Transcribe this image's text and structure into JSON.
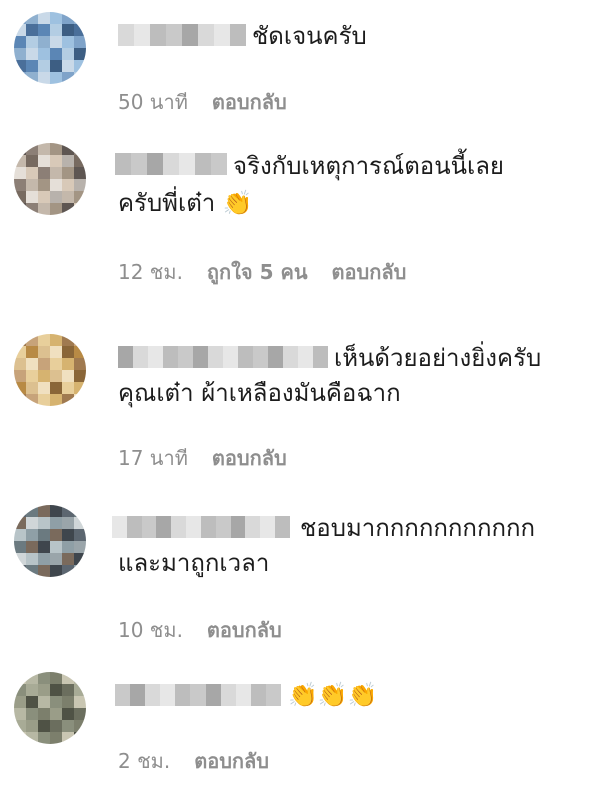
{
  "comments": [
    {
      "text_line1": "ชัดเจนครับ",
      "text_line2": "",
      "time": "50 นาที",
      "likes": "",
      "reply": "ตอบกลับ"
    },
    {
      "text_line1": "จริงกับเหตุการณ์ตอนนี้เลย",
      "text_line2": "ครับพี่เต๋า 👏",
      "time": "12 ชม.",
      "likes": "ถูกใจ 5 คน",
      "reply": "ตอบกลับ"
    },
    {
      "text_line1": "เห็นด้วยอย่างยิ่งครับ",
      "text_line2": "คุณเต๋า ผ้าเหลืองมันคือฉาก",
      "time": "17 นาที",
      "likes": "",
      "reply": "ตอบกลับ"
    },
    {
      "text_line1": "ชอบมากกกกกกกกกกก",
      "text_line2": "และมาถูกเวลา",
      "time": "10 ชม.",
      "likes": "",
      "reply": "ตอบกลับ"
    },
    {
      "text_line1": "👏👏👏",
      "text_line2": "",
      "time": "2 ชม.",
      "likes": "",
      "reply": "ตอบกลับ"
    }
  ],
  "colors": {
    "text": "#1c1c1c",
    "meta": "#8e8e8e",
    "blur": [
      "#d9d9d9",
      "#bdbdbd",
      "#a7a7a7",
      "#e7e7e7",
      "#c9c9c9"
    ]
  }
}
